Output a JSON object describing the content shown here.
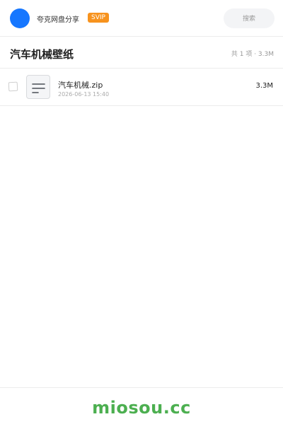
{
  "header": {
    "app_name": "夸克网盘分享",
    "badge": "SVIP",
    "search_label": "搜索"
  },
  "share": {
    "title": "汽车机械壁纸",
    "summary": "共 1 项 · 3.3M"
  },
  "files": [
    {
      "name": "汽车机械.zip",
      "date": "2026-06-13 15:40",
      "size": "3.3M",
      "icon": "zip-file-icon"
    }
  ],
  "footer": {
    "logo_text": "miosou.cc"
  },
  "colors": {
    "avatar": "#1677ff",
    "badge": "#f7931e",
    "logo": "#4caf50"
  }
}
